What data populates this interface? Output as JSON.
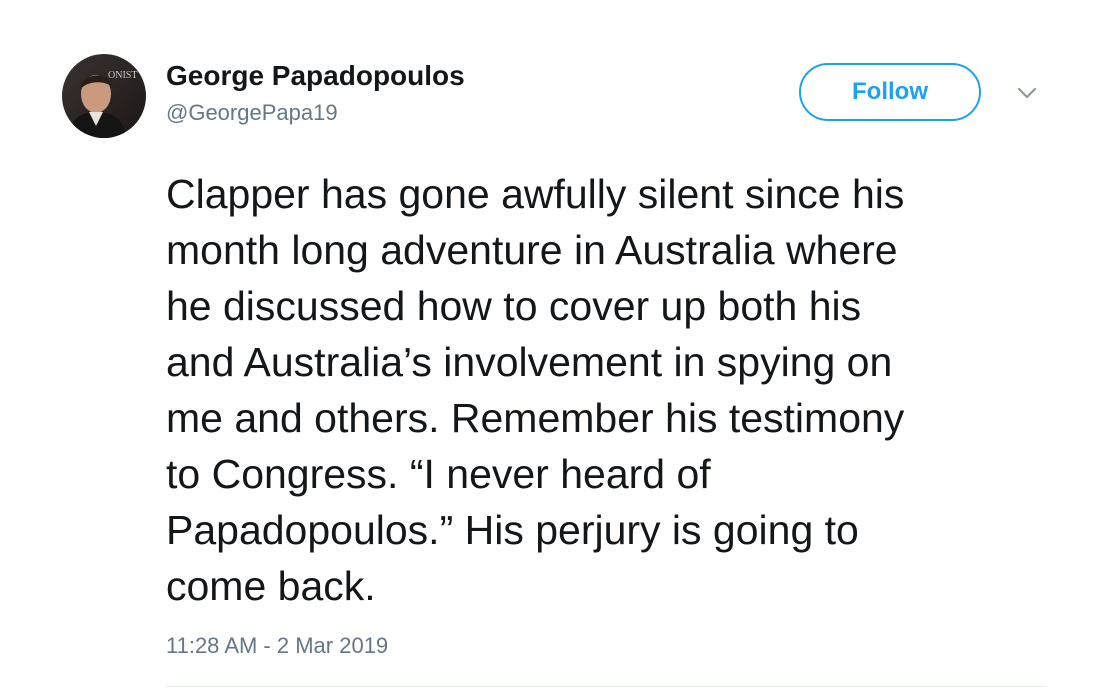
{
  "author": {
    "display_name": "George Papadopoulos",
    "handle": "@GeorgePapa19",
    "avatar_alt": "profile photo",
    "avatar_backdrop_text": "ONIST"
  },
  "actions": {
    "follow_label": "Follow",
    "more_icon": "chevron-down-icon"
  },
  "tweet": {
    "lines": [
      "Clapper has gone awfully silent since his",
      "month long adventure in Australia where",
      "he discussed how to cover up both his",
      "and Australia’s involvement in spying on",
      "me and others. Remember his testimony",
      "to Congress. “I never heard of",
      "Papadopoulos.” His perjury is going to",
      "come back."
    ],
    "timestamp": "11:28 AM - 2 Mar 2019"
  },
  "colors": {
    "accent": "#1da1f2",
    "text_primary": "#14171a",
    "text_secondary": "#657786",
    "divider": "#e6ecf0"
  }
}
